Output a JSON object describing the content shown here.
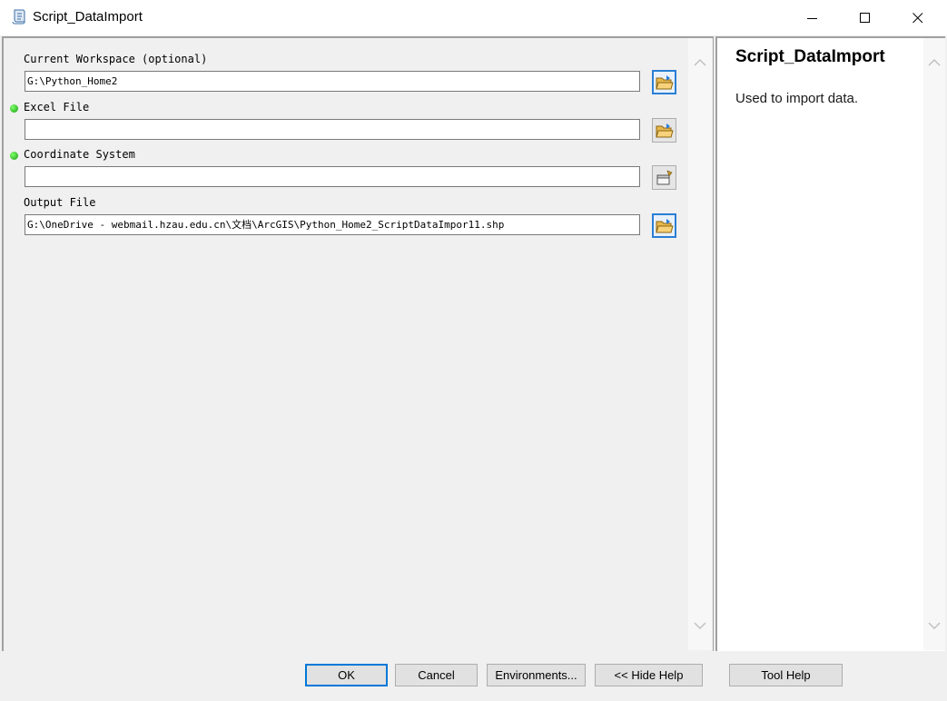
{
  "window": {
    "title": "Script_DataImport",
    "icon": "script-tool-icon",
    "controls": [
      "minimize-icon",
      "maximize-icon",
      "close-icon"
    ]
  },
  "parameters": [
    {
      "label": "Current Workspace (optional)",
      "value": "G:\\Python_Home2",
      "required": false,
      "browse_icon": "folder-open-icon"
    },
    {
      "label": "Excel File",
      "value": "",
      "required": true,
      "browse_icon": "folder-open-icon"
    },
    {
      "label": "Coordinate System",
      "value": "",
      "required": true,
      "browse_icon": "spatial-reference-icon"
    },
    {
      "label": "Output File",
      "value": "G:\\OneDrive - webmail.hzau.edu.cn\\文档\\ArcGIS\\Python_Home2_ScriptDataImpor11.shp",
      "required": false,
      "browse_icon": "folder-open-icon"
    }
  ],
  "help": {
    "title": "Script_DataImport",
    "description": "Used to import data."
  },
  "buttons": {
    "ok": "OK",
    "cancel": "Cancel",
    "environments": "Environments...",
    "hide_help": "<< Hide Help",
    "tool_help": "Tool Help"
  },
  "colors": {
    "required_dot": "#22b514",
    "focus_border": "#0078d7"
  }
}
